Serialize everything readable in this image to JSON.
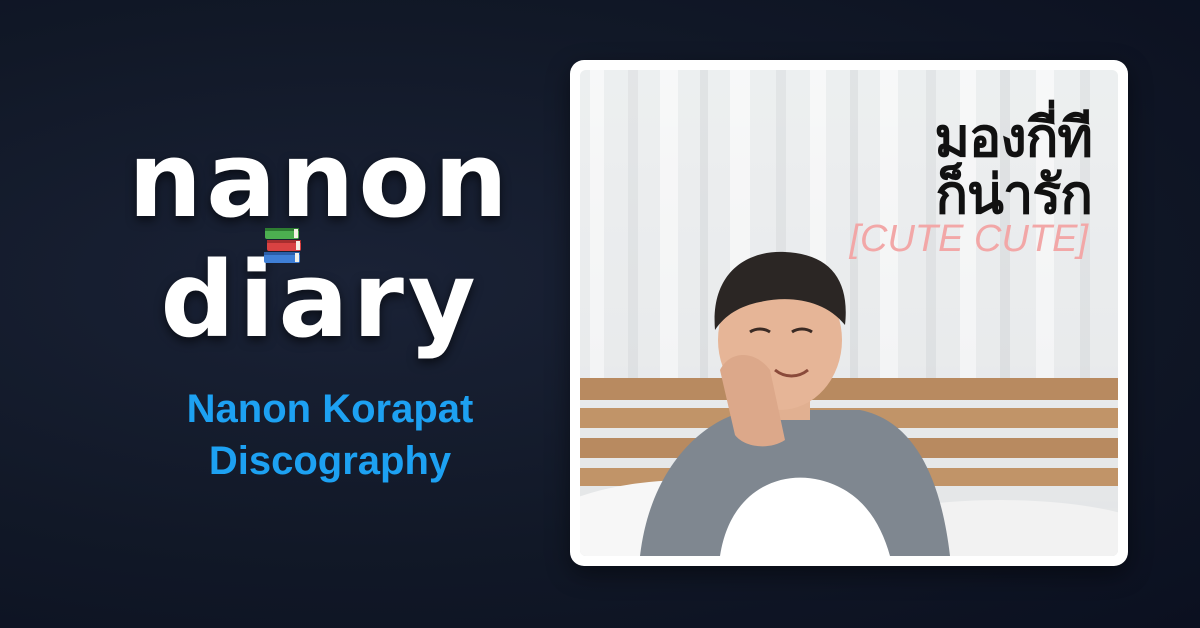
{
  "brand": {
    "line1": "nanon",
    "line2": "diary",
    "book_icon": "books-icon"
  },
  "subtitle": {
    "line1": "Nanon Korapat",
    "line2": "Discography"
  },
  "cover": {
    "title_line1": "มองกี่ที",
    "title_line2": "ก็น่ารัก",
    "subtitle": "[CUTE CUTE]"
  },
  "colors": {
    "background": "#111827",
    "accent": "#1da1f2",
    "logo_text": "#ffffff",
    "cover_subtitle": "#f2a7a7"
  }
}
